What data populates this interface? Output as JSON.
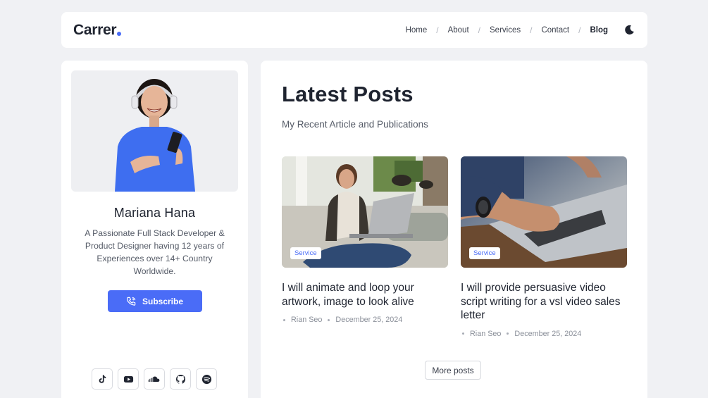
{
  "header": {
    "logo": "Carrer",
    "nav": [
      {
        "label": "Home"
      },
      {
        "label": "About"
      },
      {
        "label": "Services"
      },
      {
        "label": "Contact"
      },
      {
        "label": "Blog",
        "active": true
      }
    ],
    "theme_icon": "moon-icon"
  },
  "profile": {
    "name": "Mariana Hana",
    "bio": "A Passionate Full Stack Developer & Product Designer having 12 years of Experiences over 14+ Country Worldwide.",
    "subscribe_label": "Subscribe",
    "subscribe_icon": "phone-icon",
    "socials": [
      "tiktok-icon",
      "youtube-icon",
      "soundcloud-icon",
      "github-icon",
      "spotify-icon"
    ]
  },
  "main": {
    "title": "Latest Posts",
    "subtitle": "My Recent Article and Publications",
    "posts": [
      {
        "badge": "Service",
        "title": "I will animate and loop your artwork, image to look alive",
        "author": "Rian Seo",
        "date": "December 25, 2024"
      },
      {
        "badge": "Service",
        "title": "I will provide persuasive video script writing for a vsl video sales letter",
        "author": "Rian Seo",
        "date": "December 25, 2024"
      }
    ],
    "more_label": "More posts"
  },
  "colors": {
    "accent": "#4a6cf7",
    "background": "#f0f1f4",
    "card": "#ffffff",
    "text": "#1f2430"
  }
}
